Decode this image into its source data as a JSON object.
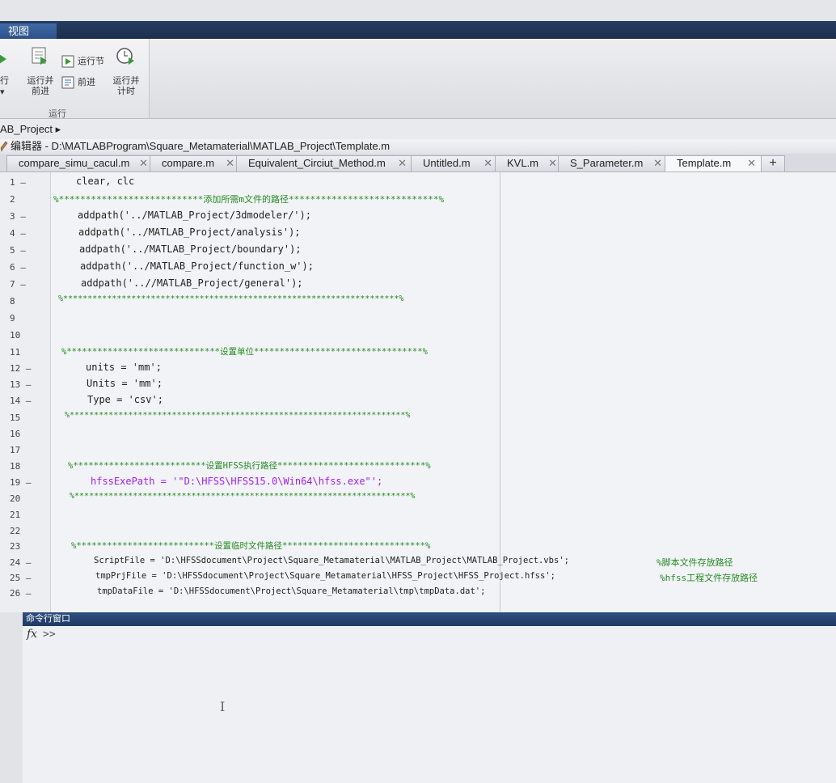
{
  "ribbon": {
    "view_tab": "视图",
    "run_label": "行",
    "run_advance_label": "运行并\n前进",
    "run_section_label": "运行节",
    "advance_label": "前进",
    "run_time_label": "运行并\n计时",
    "group_label": "运行"
  },
  "address": {
    "path": "AB_Project ▸"
  },
  "editor_title": {
    "text": "编辑器 - D:\\MATLABProgram\\Square_Metamaterial\\MATLAB_Project\\Template.m"
  },
  "tabs": [
    {
      "label": "compare_simu_cacul.m"
    },
    {
      "label": "compare.m"
    },
    {
      "label": "Equivalent_Circiut_Method.m"
    },
    {
      "label": "Untitled.m"
    },
    {
      "label": "KVL.m"
    },
    {
      "label": "S_Parameter.m"
    },
    {
      "label": "Template.m"
    }
  ],
  "tab_close": "✕",
  "tab_add": "+",
  "code": {
    "lines": [
      {
        "n": "1 —",
        "text": "clear, clc"
      },
      {
        "n": "2",
        "text": "%***************************添加所需m文件的路径****************************%"
      },
      {
        "n": "3 —",
        "text": "addpath('../MATLAB_Project/3dmodeler/');"
      },
      {
        "n": "4 —",
        "text": "addpath('../MATLAB_Project/analysis');"
      },
      {
        "n": "5 —",
        "text": "addpath('../MATLAB_Project/boundary');"
      },
      {
        "n": "6 —",
        "text": "addpath('../MATLAB_Project/function_w');"
      },
      {
        "n": "7 —",
        "text": "addpath('..//MATLAB_Project/general');"
      },
      {
        "n": "8",
        "text": "%*********************************************************************%"
      },
      {
        "n": "9",
        "text": ""
      },
      {
        "n": "10",
        "text": ""
      },
      {
        "n": "11",
        "text": "%******************************设置单位*********************************%"
      },
      {
        "n": "12 —",
        "text": "units = 'mm';"
      },
      {
        "n": "13 —",
        "text": "Units = 'mm';"
      },
      {
        "n": "14 —",
        "text": "Type = 'csv';"
      },
      {
        "n": "15",
        "text": "%*********************************************************************%"
      },
      {
        "n": "16",
        "text": ""
      },
      {
        "n": "17",
        "text": ""
      },
      {
        "n": "18",
        "text": "%**************************设置HFSS执行路径*****************************%"
      },
      {
        "n": "19 —",
        "text": "hfssExePath = '\"D:\\HFSS\\HFSS15.0\\Win64\\hfss.exe\"';"
      },
      {
        "n": "20",
        "text": "%*********************************************************************%"
      },
      {
        "n": "21",
        "text": ""
      },
      {
        "n": "22",
        "text": ""
      },
      {
        "n": "23",
        "text": "%***************************设置临时文件路径****************************%"
      },
      {
        "n": "24 —",
        "text": "ScriptFile = 'D:\\HFSSdocument\\Project\\Square_Metamaterial\\MATLAB_Project\\MATLAB_Project.vbs';",
        "comment": "%脚本文件存放路径"
      },
      {
        "n": "25 —",
        "text": "tmpPrjFile = 'D:\\HFSSdocument\\Project\\Square_Metamaterial\\HFSS_Project\\HFSS_Project.hfss';",
        "comment": "%hfss工程文件存放路径"
      },
      {
        "n": "26 —",
        "text": "tmpDataFile = 'D:\\HFSSdocument\\Project\\Square_Metamaterial\\tmp\\tmpData.dat';"
      }
    ]
  },
  "command_window": {
    "title": "命令行窗口",
    "fx": "fx",
    "prompt": ">>"
  }
}
